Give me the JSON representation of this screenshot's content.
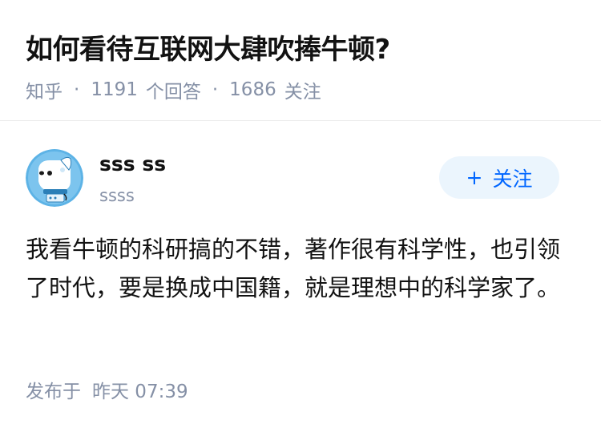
{
  "question": {
    "title": "如何看待互联网大肆吹捧牛顿?",
    "source": "知乎",
    "answer_count": "1191",
    "answer_label": "个回答",
    "follower_count": "1686",
    "follower_label": "关注"
  },
  "answer": {
    "author": {
      "name": "sss ss",
      "headline": "ssss",
      "avatar_icon": "dog-avatar-icon"
    },
    "follow_button": {
      "icon": "plus-icon",
      "label": "关注"
    },
    "content": "我看牛顿的科研搞的不错，著作很有科学性，也引领了时代，要是换成中国籍，就是理想中的科学家了。",
    "published_label": "发布于",
    "published_time": "昨天 07:39"
  },
  "colors": {
    "title": "#121212",
    "meta": "#8590a6",
    "follow_bg": "#ebf5fd",
    "follow_text": "#0066ff",
    "avatar_bg": "#5db3e6",
    "divider": "#ebebeb"
  }
}
